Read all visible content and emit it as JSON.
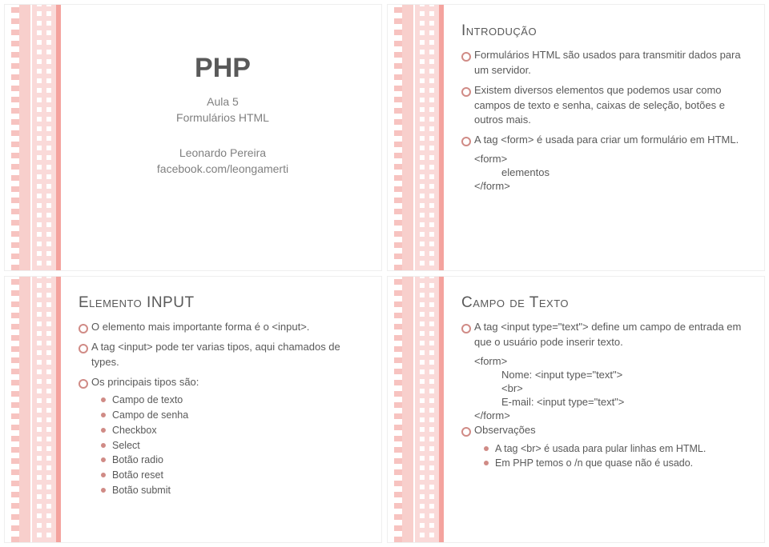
{
  "slide1": {
    "title": "PHP",
    "subtitle1": "Aula 5",
    "subtitle2": "Formulários HTML",
    "author": "Leonardo Pereira",
    "link": "facebook.com/leongamerti"
  },
  "slide2": {
    "heading": "Introdução",
    "b1": "Formulários HTML são usados para transmitir dados para um servidor.",
    "b2": "Existem diversos elementos que podemos usar como campos de texto e senha, caixas de seleção, botões e outros mais.",
    "b3": "A tag <form> é usada para criar um formulário em HTML.",
    "code1": "<form>",
    "code2": "elementos",
    "code3": "</form>"
  },
  "slide3": {
    "heading": "Elemento INPUT",
    "b1": "O elemento mais importante forma é o <input>.",
    "b2": "A tag <input> pode ter varias tipos, aqui chamados de types.",
    "b3": "Os principais tipos são:",
    "s1": "Campo de texto",
    "s2": "Campo de senha",
    "s3": "Checkbox",
    "s4": "Select",
    "s5": "Botão radio",
    "s6": "Botão reset",
    "s7": "Botão submit"
  },
  "slide4": {
    "heading": "Campo de Texto",
    "b1": "A tag <input type=\"text\"> define um campo de entrada em que o usuário pode inserir texto.",
    "code1": "<form>",
    "code2": "Nome: <input type=\"text\">",
    "code3": "<br>",
    "code4": "E-mail: <input type=\"text\">",
    "code5": "</form>",
    "b2": "Observações",
    "s1": "A tag <br> é usada para pular linhas em HTML.",
    "s2": "Em PHP temos o /n que quase não é usado."
  }
}
